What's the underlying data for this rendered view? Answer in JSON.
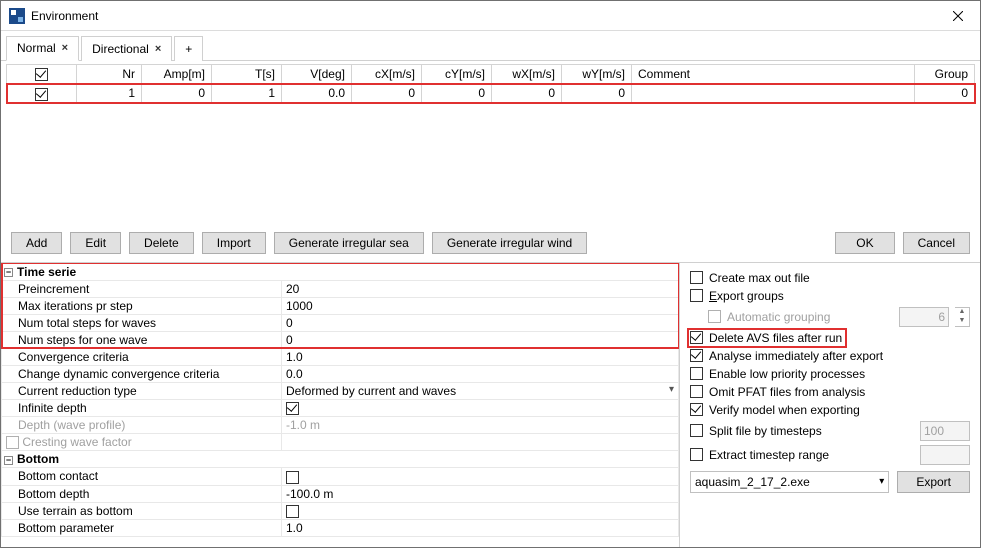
{
  "window": {
    "title": "Environment"
  },
  "tabs": {
    "normal": "Normal",
    "directional": "Directional"
  },
  "grid": {
    "headers": {
      "nr": "Nr",
      "amp": "Amp[m]",
      "ts": "T[s]",
      "vdeg": "V[deg]",
      "cx": "cX[m/s]",
      "cy": "cY[m/s]",
      "wx": "wX[m/s]",
      "wy": "wY[m/s]",
      "comment": "Comment",
      "group": "Group"
    },
    "row1": {
      "nr": "1",
      "amp": "0",
      "ts": "1",
      "vdeg": "0.0",
      "cx": "0",
      "cy": "0",
      "wx": "0",
      "wy": "0",
      "comment": "",
      "group": "0"
    }
  },
  "buttons": {
    "add": "Add",
    "edit": "Edit",
    "delete": "Delete",
    "import": "Import",
    "gensea": "Generate irregular sea",
    "genwind": "Generate irregular wind",
    "ok": "OK",
    "cancel": "Cancel",
    "export": "Export"
  },
  "sections": {
    "timeserie": "Time serie",
    "bottom": "Bottom",
    "props": {
      "preinc": {
        "label": "Preincrement",
        "val": "20"
      },
      "maxiter": {
        "label": "Max iterations pr step",
        "val": "1000"
      },
      "numtotal": {
        "label": "Num total steps for waves",
        "val": "0"
      },
      "numone": {
        "label": "Num steps for one wave",
        "val": "0"
      },
      "conv": {
        "label": "Convergence criteria",
        "val": "1.0"
      },
      "chconv": {
        "label": "Change dynamic convergence criteria",
        "val": "0.0"
      },
      "curred": {
        "label": "Current reduction type",
        "val": "Deformed by current and waves"
      },
      "infdepth": {
        "label": "Infinite depth"
      },
      "depthwp": {
        "label": "Depth (wave profile)",
        "val": "-1.0 m"
      },
      "crest": {
        "label": "Cresting wave factor"
      },
      "bcontact": {
        "label": "Bottom contact"
      },
      "bdepth": {
        "label": "Bottom depth",
        "val": "-100.0 m"
      },
      "terrain": {
        "label": "Use terrain as bottom"
      },
      "bparam": {
        "label": "Bottom parameter",
        "val": "1.0"
      }
    }
  },
  "options": {
    "createmax": "Create max out file",
    "exportgroups": "Export groups",
    "autogroup": "Automatic grouping",
    "autogroup_val": "6",
    "deleteavs": "Delete AVS files after run",
    "analyse": "Analyse immediately after export",
    "lowpriority": "Enable low priority processes",
    "omitpfat": "Omit PFAT files from analysis",
    "verify": "Verify model when exporting",
    "split": "Split file by timesteps",
    "split_val": "100",
    "extract": "Extract timestep range",
    "exe": "aquasim_2_17_2.exe"
  }
}
